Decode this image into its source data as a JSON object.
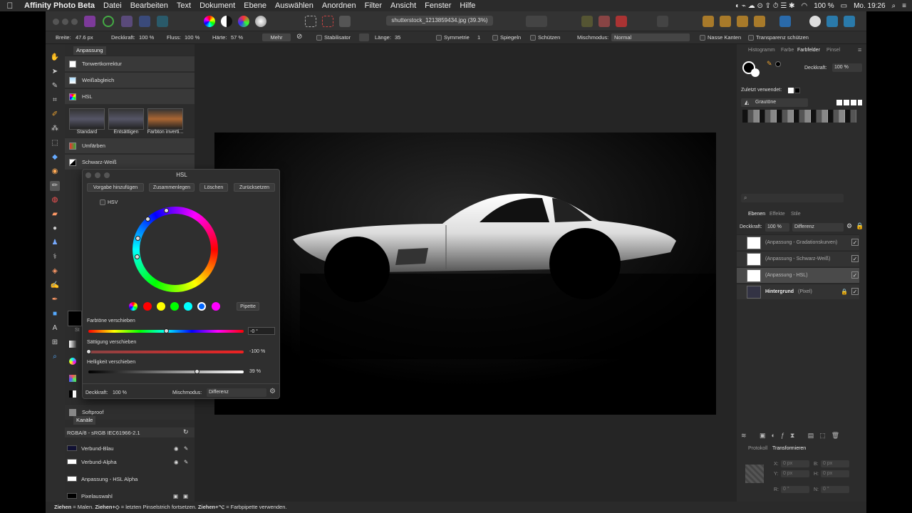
{
  "menubar": {
    "app": "Affinity Photo Beta",
    "items": [
      "Datei",
      "Bearbeiten",
      "Text",
      "Dokument",
      "Ebene",
      "Auswählen",
      "Anordnen",
      "Filter",
      "Ansicht",
      "Fenster",
      "Hilfe"
    ],
    "battery": "100 %",
    "clock": "Mo. 19:26"
  },
  "toolbar": {
    "document_tab": "shutterstock_1213859434.jpg (39.3%)"
  },
  "context": {
    "breite_label": "Breite:",
    "breite": "47.6 px",
    "deckkraft_label": "Deckkraft:",
    "deckkraft": "100 %",
    "fluss_label": "Fluss:",
    "fluss": "100 %",
    "haerte_label": "Härte:",
    "haerte": "57 %",
    "mehr": "Mehr",
    "stabilisator": "Stabilisator",
    "laenge_label": "Länge:",
    "laenge": "35",
    "symmetrie_label": "Symmetrie",
    "symmetrie": "1",
    "spiegeln": "Spiegeln",
    "schuetzen": "Schützen",
    "mischmodus_label": "Mischmodus:",
    "mischmodus": "Normal",
    "nasse_kanten": "Nasse Kanten",
    "transparenz": "Transparenz schützen"
  },
  "left": {
    "tab": "Anpassung",
    "adjustments": [
      "Tonwertkorrektur",
      "Weißabgleich",
      "HSL",
      "Umfärben",
      "Schwarz-Weiß"
    ],
    "presets": [
      "Standard",
      "Entsättigen",
      "Farbton inverti..."
    ],
    "softproof": "Softproof",
    "st_label": "St"
  },
  "channels": {
    "tab": "Kanäle",
    "profile": "RGBA/8 - sRGB IEC61966-2.1",
    "items": [
      "Verbund-Blau",
      "Verbund-Alpha",
      "Anpassung - HSL Alpha",
      "Pixelauswahl"
    ]
  },
  "hsl": {
    "title": "HSL",
    "buttons": [
      "Vorgabe hinzufügen",
      "Zusammenlegen",
      "Löschen",
      "Zurücksetzen"
    ],
    "hsv": "HSV",
    "pipette": "Pipette",
    "hue_label": "Farbtöne verschieben",
    "hue_value": "-0 °",
    "sat_label": "Sättigung verschieben",
    "sat_value": "-100 %",
    "light_label": "Helligkeit verschieben",
    "light_value": "39 %",
    "opacity_label": "Deckkraft:",
    "opacity": "100 %",
    "blend_label": "Mischmodus:",
    "blend": "Differenz",
    "hue": 0,
    "saturation": -100,
    "lightness": 39,
    "swatches": [
      "#ff0000",
      "#ffff00",
      "#00ff00",
      "#00ffff",
      "#0066ff",
      "#ff00ff"
    ]
  },
  "right": {
    "tabs": [
      "Histogramm",
      "Farbe",
      "Farbfelder",
      "Pinsel"
    ],
    "deckkraft_label": "Deckkraft:",
    "deckkraft": "100 %",
    "recent": "Zuletzt verwendet:",
    "palette": "Grautöne"
  },
  "layers": {
    "tabs": [
      "Ebenen",
      "Effekte",
      "Stile"
    ],
    "deckkraft_label": "Deckkraft:",
    "deckkraft": "100 %",
    "blend": "Differenz",
    "items": [
      "(Anpassung - Gradationskurven)",
      "(Anpassung - Schwarz-Weiß)",
      "(Anpassung - HSL)",
      "Hintergrund"
    ],
    "bg_type": "(Pixel)"
  },
  "transform": {
    "tabs": [
      "Protokoll",
      "Transformieren"
    ],
    "x": "0 px",
    "y": "0 px",
    "b": "0 px",
    "h": "0 px",
    "r": "0 °",
    "s": "0 °"
  },
  "status": {
    "b1": "Ziehen",
    "t1": " = Malen. ",
    "b2": "Ziehen+◇",
    "t2": " = letzten Pinselstrich fortsetzen. ",
    "b3": "Ziehen+⌥",
    "t3": " = Farbpipette verwenden."
  }
}
